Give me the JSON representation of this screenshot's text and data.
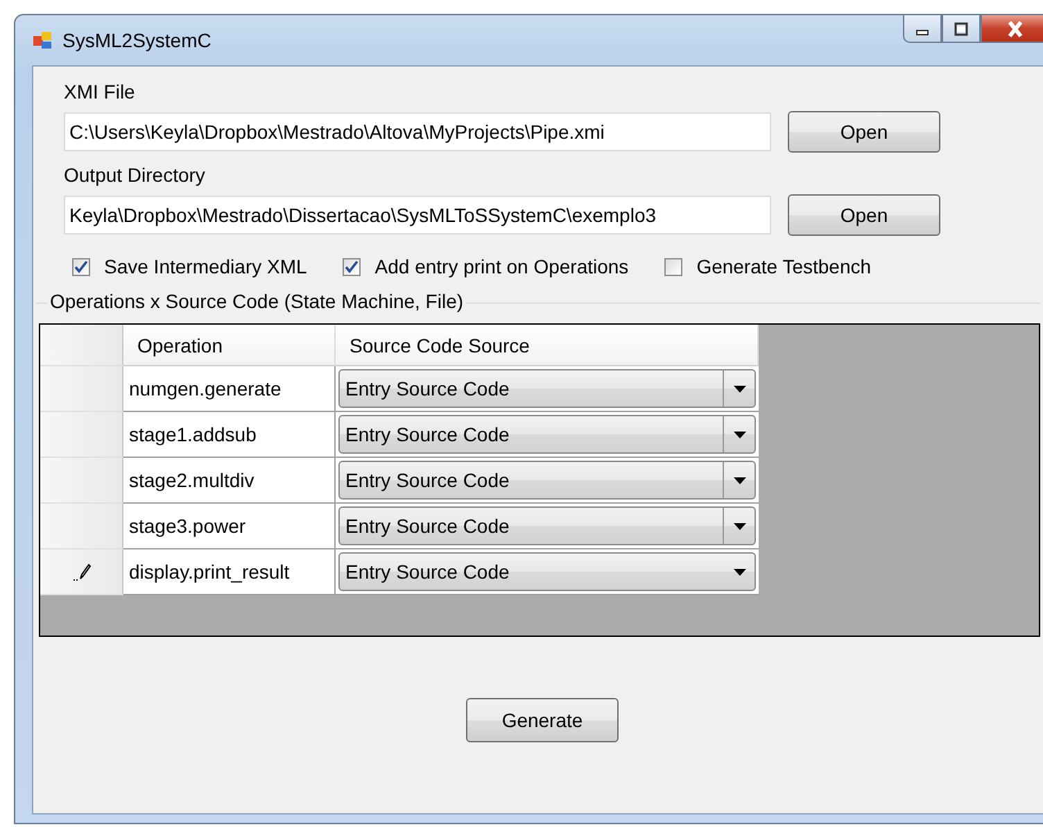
{
  "window": {
    "title": "SysML2SystemC"
  },
  "xmi_file": {
    "label": "XMI File",
    "value": "C:\\Users\\Keyla\\Dropbox\\Mestrado\\Altova\\MyProjects\\Pipe.xmi",
    "button": "Open"
  },
  "output_directory": {
    "label": "Output Directory",
    "value": "Keyla\\Dropbox\\Mestrado\\Dissertacao\\SysMLToSSystemC\\exemplo3",
    "button": "Open"
  },
  "options": [
    {
      "label": "Save Intermediary XML",
      "checked": true
    },
    {
      "label": "Add entry print on Operations",
      "checked": true
    },
    {
      "label": "Generate Testbench",
      "checked": false
    }
  ],
  "group": {
    "title": "Operations x Source Code (State Machine, File)"
  },
  "table": {
    "columns": [
      "Operation",
      "Source Code Source"
    ],
    "rows": [
      {
        "operation": "numgen.generate",
        "source": "Entry Source Code",
        "editing": false
      },
      {
        "operation": "stage1.addsub",
        "source": "Entry Source Code",
        "editing": false
      },
      {
        "operation": "stage2.multdiv",
        "source": "Entry Source Code",
        "editing": false
      },
      {
        "operation": "stage3.power",
        "source": "Entry Source Code",
        "editing": false
      },
      {
        "operation": "display.print_result",
        "source": "Entry Source Code",
        "editing": true
      }
    ]
  },
  "generate_button": "Generate"
}
